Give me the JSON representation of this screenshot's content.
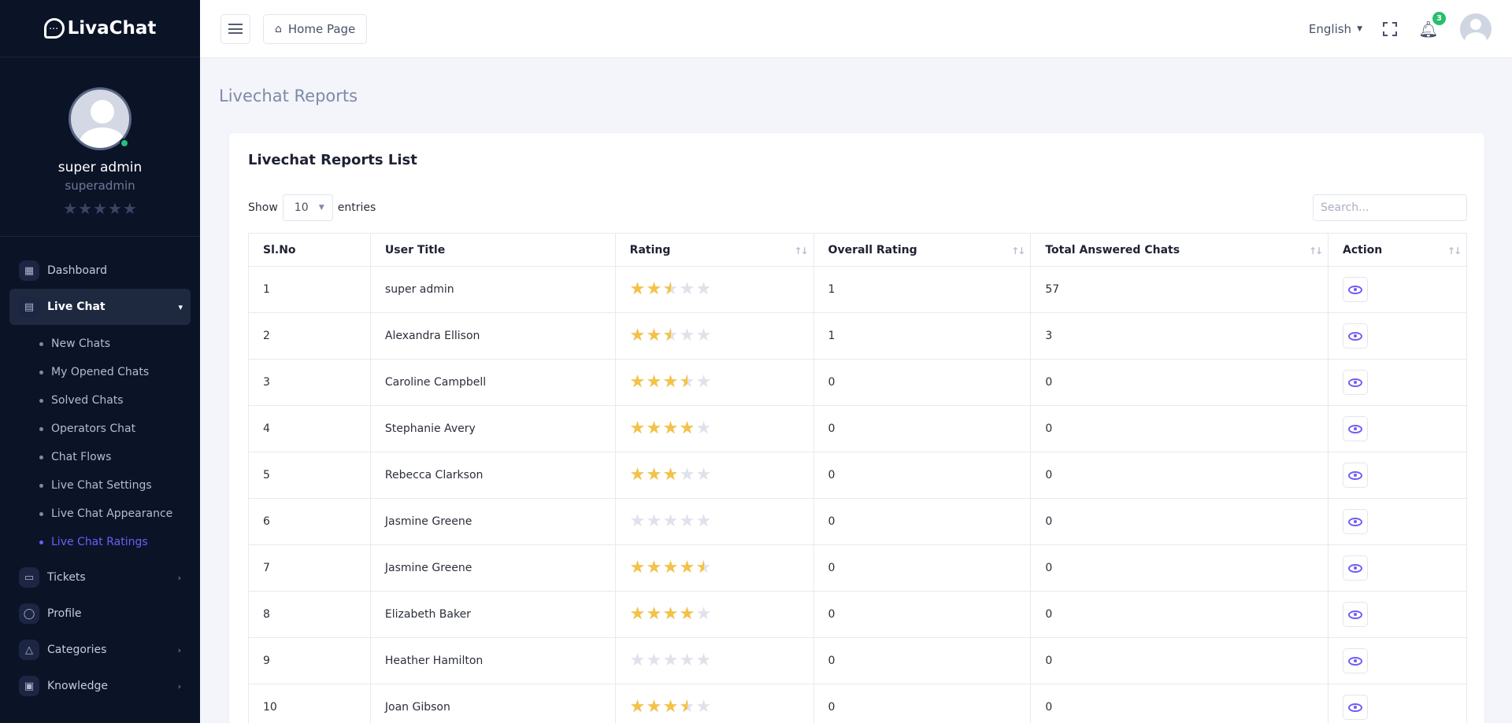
{
  "brand": {
    "name": "LivaChat"
  },
  "sidebar": {
    "user": {
      "name": "super admin",
      "role": "superadmin"
    },
    "nav": [
      {
        "label": "Dashboard",
        "icon": "grid-icon"
      },
      {
        "label": "Live Chat",
        "icon": "chat-icon",
        "active": true
      },
      {
        "label": "Tickets",
        "icon": "ticket-icon"
      },
      {
        "label": "Profile",
        "icon": "user-icon"
      },
      {
        "label": "Categories",
        "icon": "shapes-icon"
      },
      {
        "label": "Knowledge",
        "icon": "note-icon"
      }
    ],
    "live_chat_sub": [
      {
        "label": "New Chats"
      },
      {
        "label": "My Opened Chats"
      },
      {
        "label": "Solved Chats"
      },
      {
        "label": "Operators Chat"
      },
      {
        "label": "Chat Flows"
      },
      {
        "label": "Live Chat Settings"
      },
      {
        "label": "Live Chat Appearance"
      },
      {
        "label": "Live Chat Ratings",
        "current": true
      }
    ]
  },
  "topbar": {
    "home_label": "Home Page",
    "language": "English",
    "notification_count": "3"
  },
  "page": {
    "title": "Livechat Reports",
    "card_title": "Livechat Reports List",
    "show_label": "Show",
    "entries_value": "10",
    "entries_label": "entries",
    "search_placeholder": "Search..."
  },
  "table": {
    "headers": [
      "Sl.No",
      "User Title",
      "Rating",
      "Overall Rating",
      "Total Answered Chats",
      "Action"
    ],
    "rows": [
      {
        "no": "1",
        "user": "super admin",
        "rating": 2.5,
        "overall": "1",
        "answered": "57"
      },
      {
        "no": "2",
        "user": "Alexandra Ellison",
        "rating": 2.5,
        "overall": "1",
        "answered": "3"
      },
      {
        "no": "3",
        "user": "Caroline Campbell",
        "rating": 3.5,
        "overall": "0",
        "answered": "0"
      },
      {
        "no": "4",
        "user": "Stephanie Avery",
        "rating": 4,
        "overall": "0",
        "answered": "0"
      },
      {
        "no": "5",
        "user": "Rebecca Clarkson",
        "rating": 3,
        "overall": "0",
        "answered": "0"
      },
      {
        "no": "6",
        "user": "Jasmine Greene",
        "rating": 0,
        "overall": "0",
        "answered": "0"
      },
      {
        "no": "7",
        "user": "Jasmine Greene",
        "rating": 4.5,
        "overall": "0",
        "answered": "0"
      },
      {
        "no": "8",
        "user": "Elizabeth Baker",
        "rating": 4,
        "overall": "0",
        "answered": "0"
      },
      {
        "no": "9",
        "user": "Heather Hamilton",
        "rating": 0,
        "overall": "0",
        "answered": "0"
      },
      {
        "no": "10",
        "user": "Joan Gibson",
        "rating": 3.5,
        "overall": "0",
        "answered": "0"
      }
    ]
  },
  "colors": {
    "accent": "#6f5cf6",
    "star": "#f4c247",
    "sidebar": "#0b1327",
    "online": "#1fc27b"
  }
}
